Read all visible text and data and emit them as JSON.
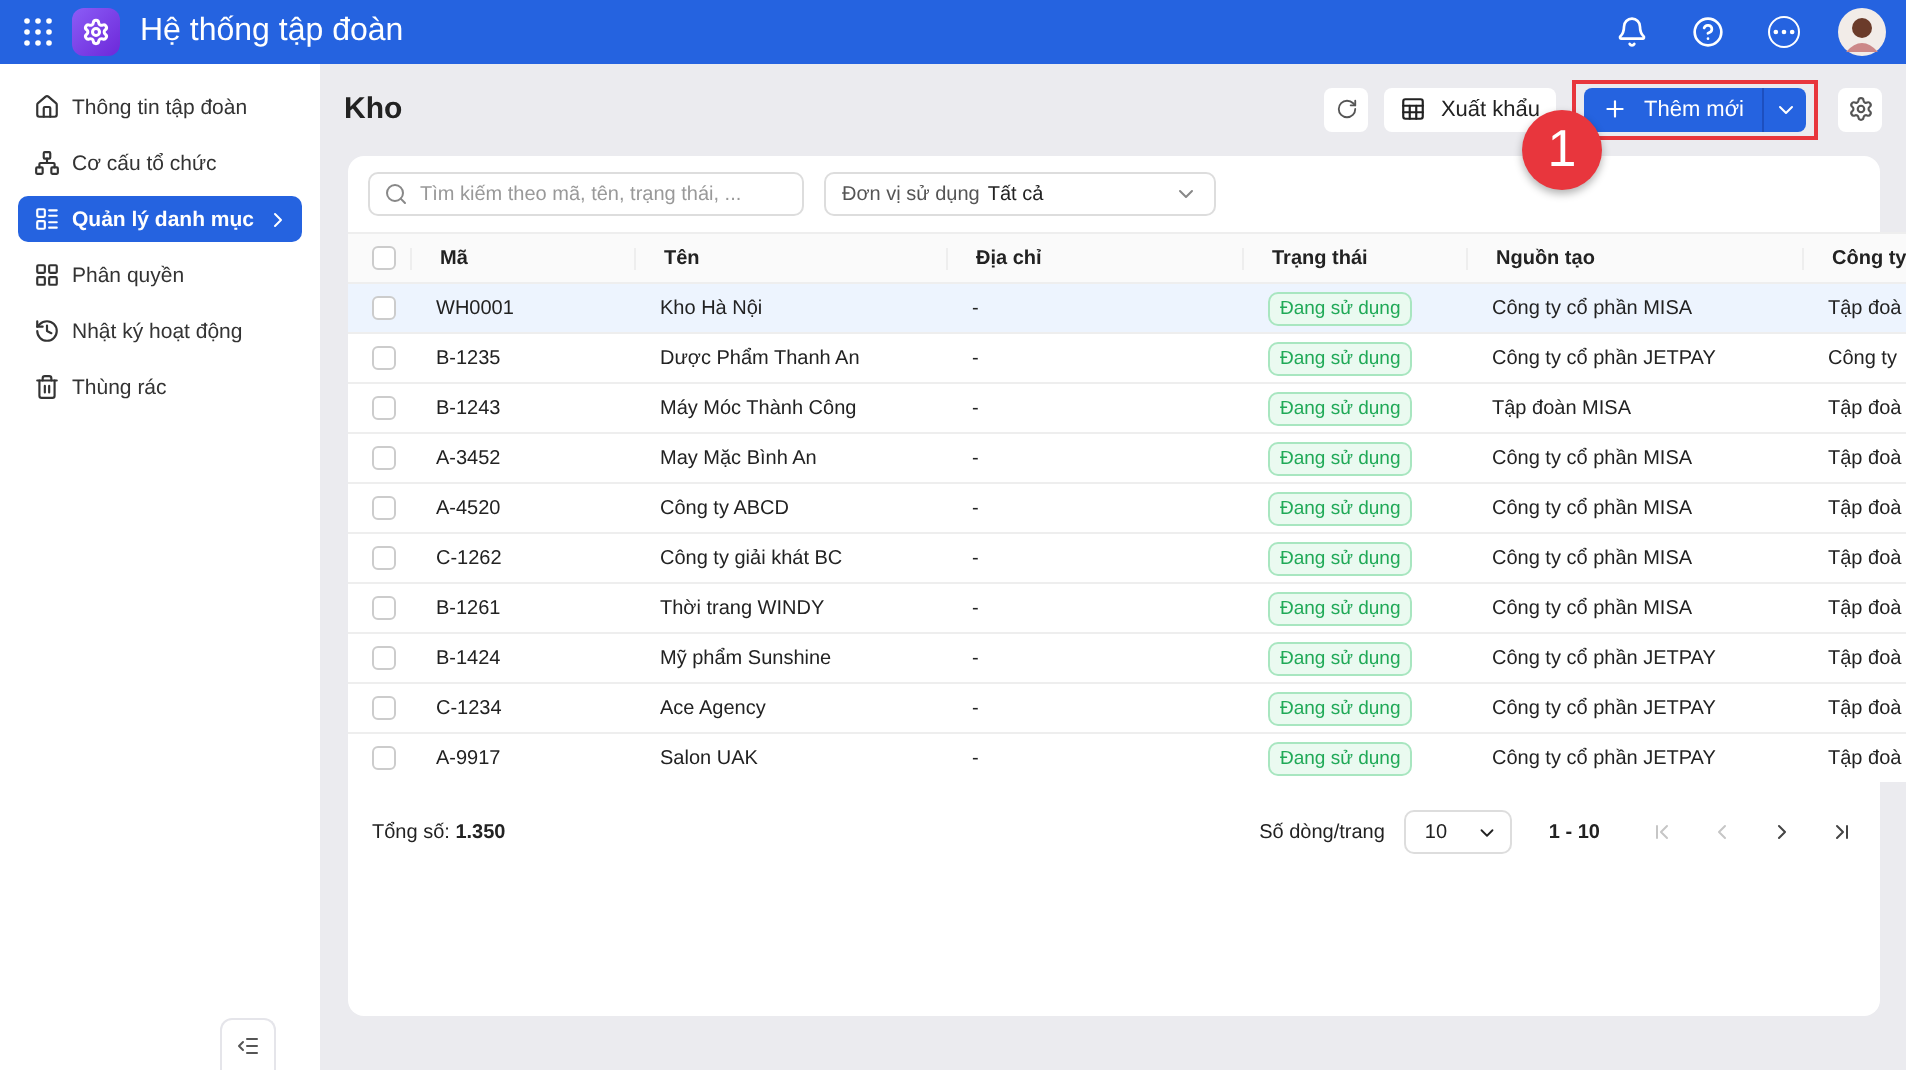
{
  "app": {
    "title": "Hệ thống tập đoàn"
  },
  "sidebar": {
    "items": [
      {
        "label": "Thông tin tập đoàn",
        "selected": false
      },
      {
        "label": "Cơ cấu tổ chức",
        "selected": false
      },
      {
        "label": "Quản lý danh mục",
        "selected": true
      },
      {
        "label": "Phân quyền",
        "selected": false
      },
      {
        "label": "Nhật ký hoạt động",
        "selected": false
      },
      {
        "label": "Thùng rác",
        "selected": false
      }
    ]
  },
  "page": {
    "title": "Kho",
    "export_label": "Xuất khẩu",
    "add_label": "Thêm mới",
    "callout": "1"
  },
  "filters": {
    "search_placeholder": "Tìm kiếm theo mã, tên, trạng thái, ...",
    "unit_label": "Đơn vị sử dụng",
    "unit_value": "Tất cả"
  },
  "table": {
    "all_checked": false,
    "columns": [
      "Mã",
      "Tên",
      "Địa chỉ",
      "Trạng thái",
      "Nguồn tạo",
      "Công ty"
    ],
    "rows": [
      {
        "code": "WH0001",
        "name": "Kho Hà Nội",
        "address": "-",
        "status": "Đang sử dụng",
        "source": "Công ty cổ phần MISA",
        "company": "Tập đoà",
        "checked": false,
        "highlighted": true
      },
      {
        "code": "B-1235",
        "name": "Dược Phẩm Thanh An",
        "address": "-",
        "status": "Đang sử dụng",
        "source": "Công ty cổ phần JETPAY",
        "company": "Công ty",
        "checked": false,
        "highlighted": false
      },
      {
        "code": "B-1243",
        "name": "Máy Móc Thành Công",
        "address": "-",
        "status": "Đang sử dụng",
        "source": "Tập đoàn MISA",
        "company": "Tập đoà",
        "checked": false,
        "highlighted": false
      },
      {
        "code": "A-3452",
        "name": "May Mặc Bình An",
        "address": "-",
        "status": "Đang sử dụng",
        "source": "Công ty cổ phần MISA",
        "company": "Tập đoà",
        "checked": false,
        "highlighted": false
      },
      {
        "code": "A-4520",
        "name": "Công ty ABCD",
        "address": "-",
        "status": "Đang sử dụng",
        "source": "Công ty cổ phần MISA",
        "company": "Tập đoà",
        "checked": false,
        "highlighted": false
      },
      {
        "code": "C-1262",
        "name": "Công ty giải khát BC",
        "address": "-",
        "status": "Đang sử dụng",
        "source": "Công ty cổ phần MISA",
        "company": "Tập đoà",
        "checked": false,
        "highlighted": false
      },
      {
        "code": "B-1261",
        "name": "Thời trang WINDY",
        "address": "-",
        "status": "Đang sử dụng",
        "source": "Công ty cổ phần MISA",
        "company": "Tập đoà",
        "checked": false,
        "highlighted": false
      },
      {
        "code": "B-1424",
        "name": "Mỹ phẩm Sunshine",
        "address": "-",
        "status": "Đang sử dụng",
        "source": "Công ty cổ phần JETPAY",
        "company": "Tập đoà",
        "checked": false,
        "highlighted": false
      },
      {
        "code": "C-1234",
        "name": "Ace Agency",
        "address": "-",
        "status": "Đang sử dụng",
        "source": "Công ty cổ phần JETPAY",
        "company": "Tập đoà",
        "checked": false,
        "highlighted": false
      },
      {
        "code": "A-9917",
        "name": "Salon UAK",
        "address": "-",
        "status": "Đang sử dụng",
        "source": "Công ty cổ phần JETPAY",
        "company": "Tập đoà",
        "checked": false,
        "highlighted": false
      }
    ]
  },
  "footer": {
    "total_label": "Tổng số:",
    "total_value": "1.350",
    "per_page_label": "Số dòng/trang",
    "per_page_value": "10",
    "range": "1 - 10",
    "first_disabled": true,
    "prev_disabled": true
  }
}
